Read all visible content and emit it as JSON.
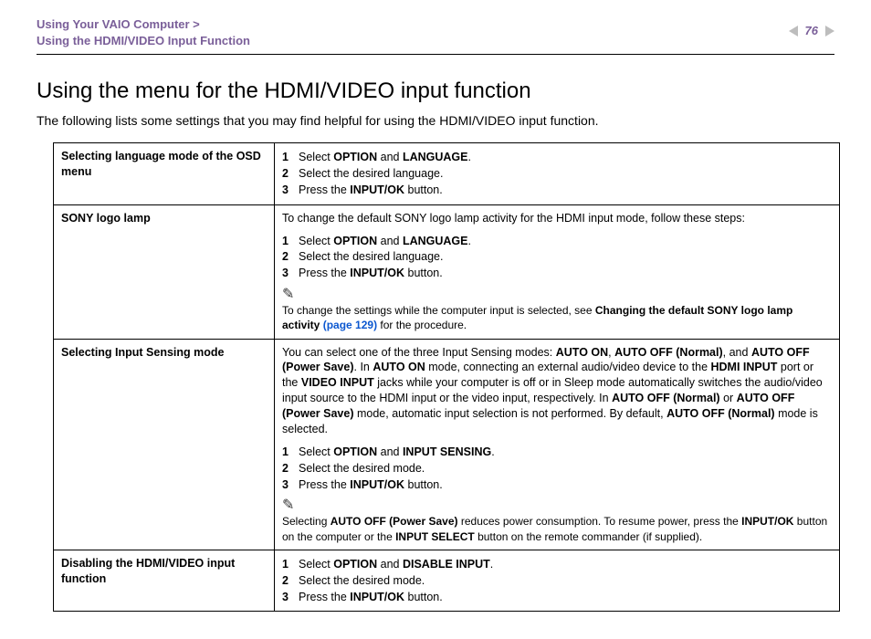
{
  "header": {
    "crumb1": "Using Your VAIO Computer >",
    "crumb2": "Using the HDMI/VIDEO Input Function",
    "page_number": "76"
  },
  "title": "Using the menu for the HDMI/VIDEO input function",
  "intro": "The following lists some settings that you may find helpful for using the HDMI/VIDEO input function.",
  "rows": {
    "r1": {
      "label": "Selecting language mode of the OSD menu",
      "s1a": "Select ",
      "s1b": "OPTION",
      "s1c": " and ",
      "s1d": "LANGUAGE",
      "s1e": ".",
      "s2": "Select the desired language.",
      "s3a": "Press the ",
      "s3b": "INPUT/OK",
      "s3c": " button."
    },
    "r2": {
      "label": "SONY logo lamp",
      "para": "To change the default SONY logo lamp activity for the HDMI input mode, follow these steps:",
      "s1a": "Select ",
      "s1b": "OPTION",
      "s1c": " and ",
      "s1d": "LANGUAGE",
      "s1e": ".",
      "s2": "Select the desired language.",
      "s3a": "Press the ",
      "s3b": "INPUT/OK",
      "s3c": " button.",
      "note1": "To change the settings while the computer input is selected, see ",
      "note2": "Changing the default SONY logo lamp activity ",
      "note_link": "(page 129)",
      "note3": " for the procedure."
    },
    "r3": {
      "label": "Selecting Input Sensing mode",
      "p": {
        "a": "You can select one of the three Input Sensing modes: ",
        "b": "AUTO ON",
        "c": ", ",
        "d": "AUTO OFF (Normal)",
        "e": ", and ",
        "f": "AUTO OFF (Power Save)",
        "g": ". In ",
        "h": "AUTO ON",
        "i": " mode, connecting an external audio/video device to the ",
        "j": "HDMI INPUT",
        "k": " port or the ",
        "l": "VIDEO INPUT",
        "m": " jacks while your computer is off or in Sleep mode automatically switches the audio/video input source to the HDMI input or the video input, respectively. In ",
        "n": "AUTO OFF (Normal)",
        "o": " or ",
        "p2": "AUTO OFF (Power Save)",
        "q": " mode, automatic input selection is not performed. By default, ",
        "r": "AUTO OFF (Normal)",
        "s": " mode is selected."
      },
      "s1a": "Select ",
      "s1b": "OPTION",
      "s1c": " and ",
      "s1d": "INPUT SENSING",
      "s1e": ".",
      "s2": "Select the desired mode.",
      "s3a": "Press the ",
      "s3b": "INPUT/OK",
      "s3c": " button.",
      "note": {
        "a": "Selecting ",
        "b": "AUTO OFF (Power Save)",
        "c": " reduces power consumption. To resume power, press the ",
        "d": "INPUT/OK",
        "e": " button on the computer or the ",
        "f": "INPUT SELECT",
        "g": " button on the remote commander (if supplied)."
      }
    },
    "r4": {
      "label": "Disabling the HDMI/VIDEO input function",
      "s1a": "Select ",
      "s1b": "OPTION",
      "s1c": " and ",
      "s1d": "DISABLE INPUT",
      "s1e": ".",
      "s2": "Select the desired mode.",
      "s3a": "Press the ",
      "s3b": "INPUT/OK",
      "s3c": " button."
    }
  },
  "nums": {
    "n1": "1",
    "n2": "2",
    "n3": "3"
  },
  "icon": "✎"
}
